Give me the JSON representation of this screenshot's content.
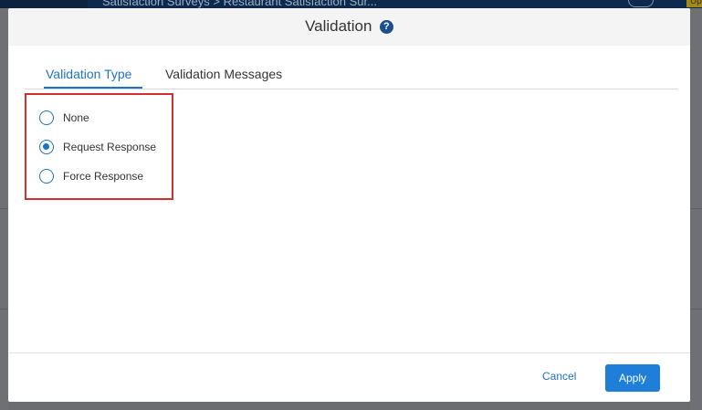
{
  "background": {
    "breadcrumb": "Satisfaction Surveys  >  Restaurant Satisfaction Sur...",
    "upgrade_label": "Upg"
  },
  "modal": {
    "title": "Validation",
    "help_icon": "?",
    "tabs": [
      {
        "label": "Validation Type",
        "active": true
      },
      {
        "label": "Validation Messages",
        "active": false
      }
    ],
    "options": [
      {
        "label": "None",
        "checked": false
      },
      {
        "label": "Request Response",
        "checked": true
      },
      {
        "label": "Force Response",
        "checked": false
      }
    ],
    "cancel_label": "Cancel",
    "apply_label": "Apply"
  },
  "colors": {
    "accent": "#1f73c7",
    "highlight_border": "#d32f2f",
    "apply_button": "#1f7fd8"
  }
}
